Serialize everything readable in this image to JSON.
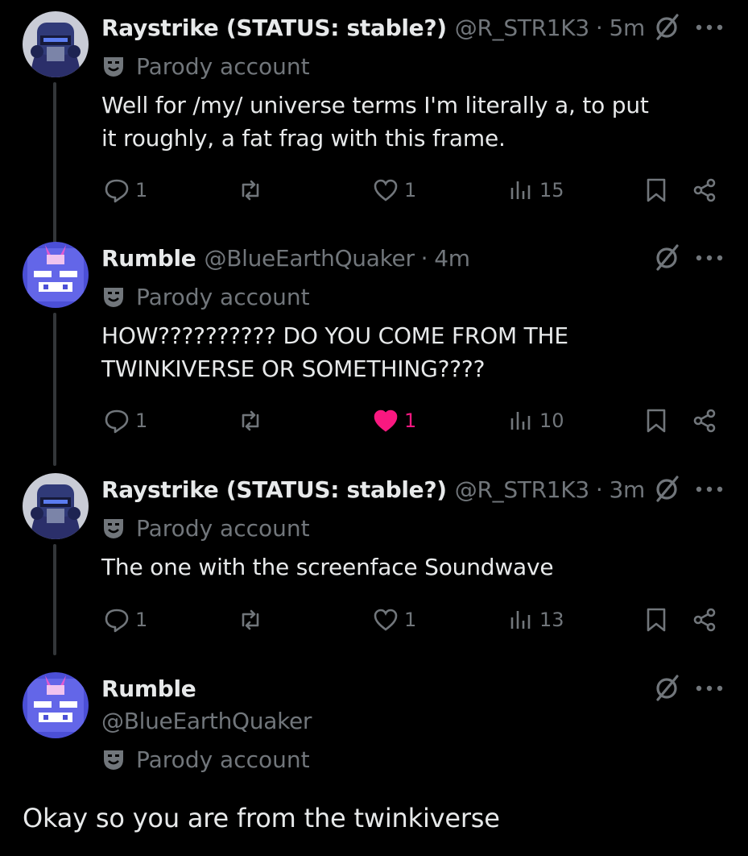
{
  "icons": {
    "parody": "drama-mask-icon",
    "reply": "reply-bubble-icon",
    "repost": "repost-icon",
    "like": "heart-icon",
    "views": "bar-chart-icon",
    "bookmark": "bookmark-icon",
    "share": "share-icon",
    "grok": "slashed-circle-icon",
    "more": "more-dots-icon"
  },
  "colors": {
    "background": "#000000",
    "muted": "#71767b",
    "text": "#e7e9ea",
    "like_active": "#f91880"
  },
  "tweets": [
    {
      "name": "Raystrike (STATUS: stable?)",
      "handle": "@R_STR1K3",
      "separator": "·",
      "time": "5m",
      "parody_label": "Parody account",
      "text": "Well for /my/ universe terms I'm literally a, to put it roughly, a fat frag with this frame.",
      "replies": "1",
      "reposts": "",
      "likes": "1",
      "liked": false,
      "views": "15"
    },
    {
      "name": "Rumble",
      "handle": "@BlueEarthQuaker",
      "separator": "·",
      "time": "4m",
      "parody_label": "Parody account",
      "text": "HOW?????????? DO YOU COME FROM THE TWINKIVERSE OR SOMETHING????",
      "replies": "1",
      "reposts": "",
      "likes": "1",
      "liked": true,
      "views": "10"
    },
    {
      "name": "Raystrike (STATUS: stable?)",
      "handle": "@R_STR1K3",
      "separator": "·",
      "time": "3m",
      "parody_label": "Parody account",
      "text": "The one with the screenface Soundwave",
      "replies": "1",
      "reposts": "",
      "likes": "1",
      "liked": false,
      "views": "13"
    },
    {
      "name": "Rumble",
      "handle": "@BlueEarthQuaker",
      "parody_label": "Parody account"
    }
  ],
  "main_text": "Okay so you are from the twinkiverse"
}
